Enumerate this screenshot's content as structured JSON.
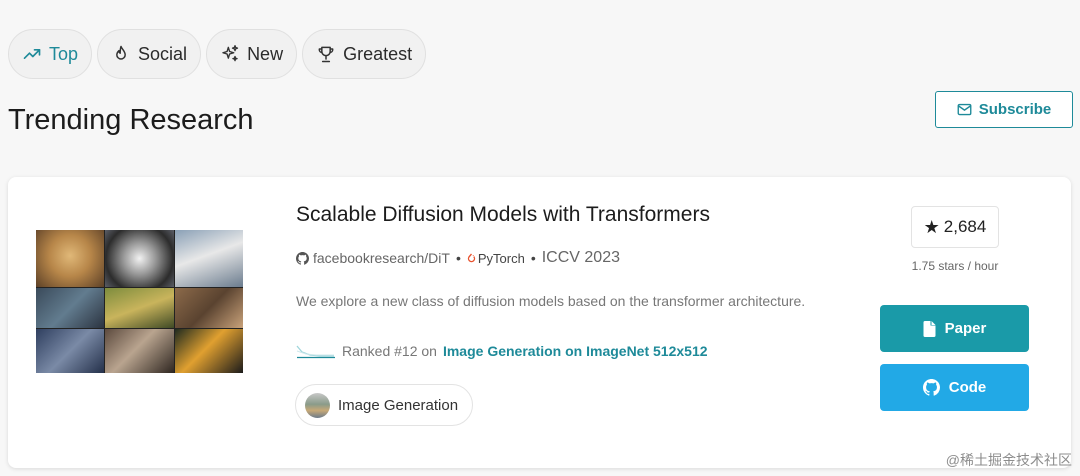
{
  "tabs": [
    {
      "label": "Top",
      "icon": "trending-up-icon",
      "active": true
    },
    {
      "label": "Social",
      "icon": "flame-icon",
      "active": false
    },
    {
      "label": "New",
      "icon": "sparkles-icon",
      "active": false
    },
    {
      "label": "Greatest",
      "icon": "trophy-icon",
      "active": false
    }
  ],
  "page_title": "Trending Research",
  "subscribe_label": "Subscribe",
  "paper": {
    "title": "Scalable Diffusion Models with Transformers",
    "repo": "facebookresearch/DiT",
    "framework": "PyTorch",
    "venue": "ICCV 2023",
    "abstract": "We explore a new class of diffusion models based on the transformer architecture.",
    "rank_prefix": "Ranked #12 on",
    "rank_task": "Image Generation on ImageNet 512x512",
    "task_chip": "Image Generation",
    "stars": "2,684",
    "stars_rate": "1.75 stars / hour",
    "paper_button": "Paper",
    "code_button": "Code"
  },
  "colors": {
    "accent": "#1e8a99",
    "paper_button": "#1a9aa8",
    "code_button": "#22a9e6"
  },
  "watermark": "@稀土掘金技术社区"
}
